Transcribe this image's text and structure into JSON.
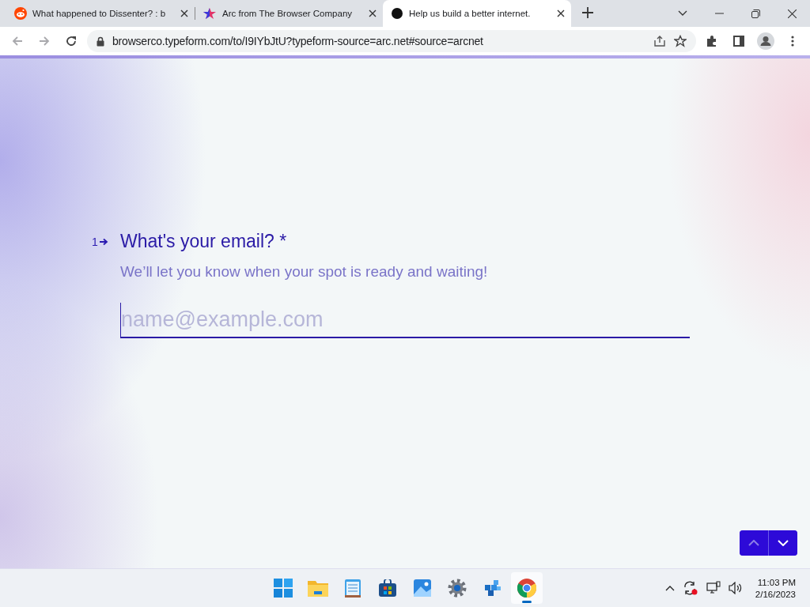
{
  "browser": {
    "tabs": [
      {
        "kind": "reddit",
        "title": "What happened to Dissenter? : b",
        "selected": false
      },
      {
        "kind": "arc",
        "title": "Arc from The Browser Company",
        "selected": false
      },
      {
        "kind": "dot",
        "title": "Help us build a better internet.",
        "selected": true
      }
    ],
    "address": "browserco.typeform.com/to/I9IYbJtU?typeform-source=arc.net#source=arcnet"
  },
  "form": {
    "number": "1",
    "question": "What's your email? *",
    "description": "We’ll let you know when your spot is ready and waiting!",
    "email": {
      "placeholder": "name@example.com"
    },
    "nav": [
      {
        "kind": "up",
        "disabled": true
      },
      {
        "kind": "down",
        "disabled": false
      }
    ]
  },
  "taskbar": {
    "apps": [
      {
        "kind": "start",
        "selected": false
      },
      {
        "kind": "folder",
        "selected": false
      },
      {
        "kind": "notepad",
        "selected": false
      },
      {
        "kind": "store",
        "selected": false
      },
      {
        "kind": "photos",
        "selected": false
      },
      {
        "kind": "settings",
        "selected": false
      },
      {
        "kind": "cubes",
        "selected": false
      },
      {
        "kind": "chrome",
        "selected": true
      }
    ],
    "time": "11:03 PM",
    "date": "2/16/2023"
  }
}
